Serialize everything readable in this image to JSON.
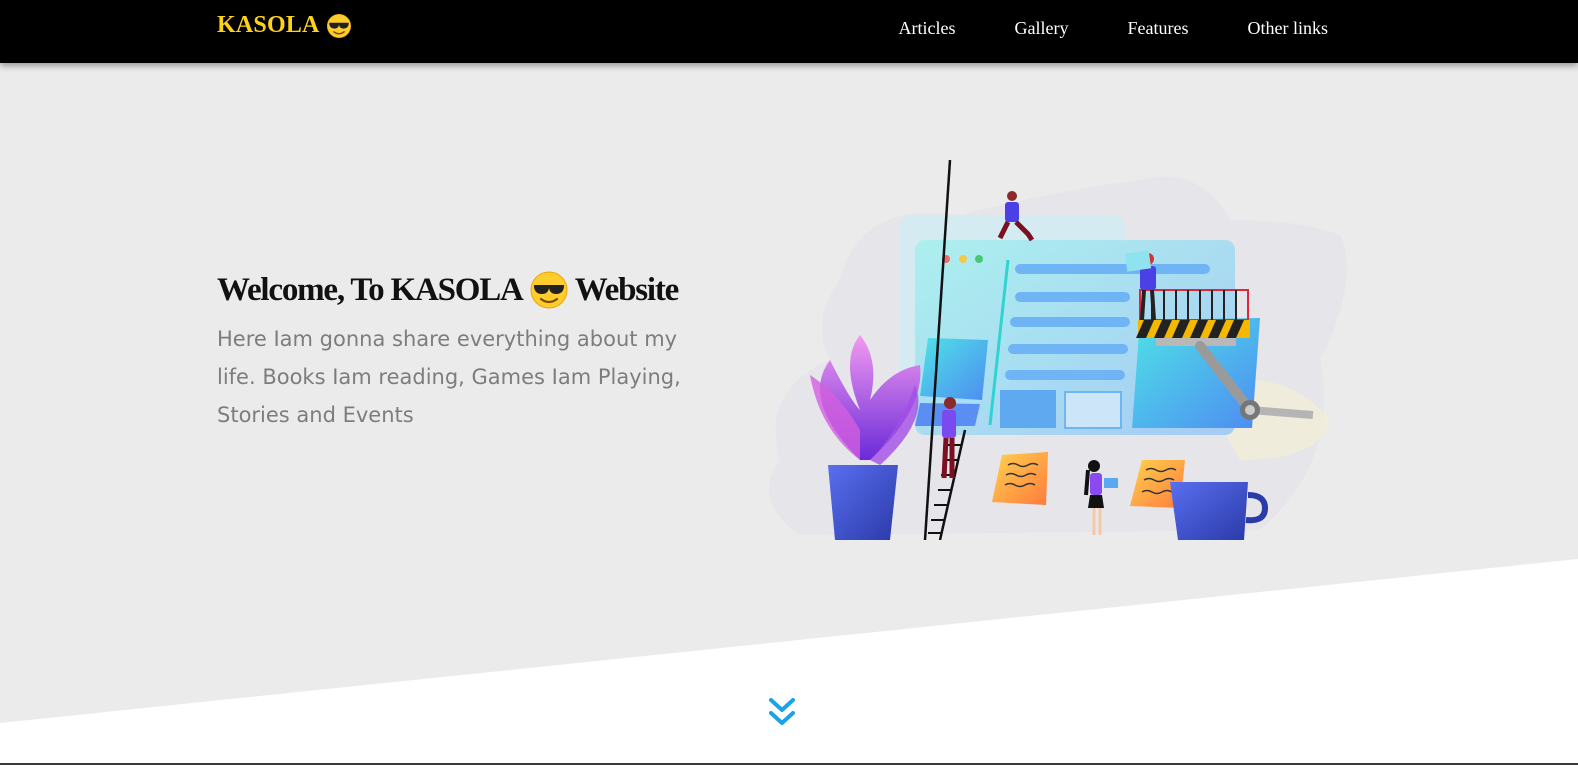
{
  "navbar": {
    "brand": "KASOLA",
    "brand_icon": "sunglasses-emoji-icon",
    "links": [
      {
        "label": "Articles"
      },
      {
        "label": "Gallery"
      },
      {
        "label": "Features"
      },
      {
        "label": "Other links"
      }
    ]
  },
  "hero": {
    "title_prefix": "Welcome, To KASOLA",
    "title_suffix": "Website",
    "subtitle": "Here Iam gonna share everything about my life. Books Iam reading, Games Iam Playing, Stories and Events",
    "illustration": "website-construction-illustration",
    "scroll_icon": "double-chevron-down-icon"
  },
  "colors": {
    "navbar_bg": "#000000",
    "brand": "#ffd21a",
    "hero_bg": "#ebebeb",
    "scroll_icon": "#1aa3e8"
  }
}
